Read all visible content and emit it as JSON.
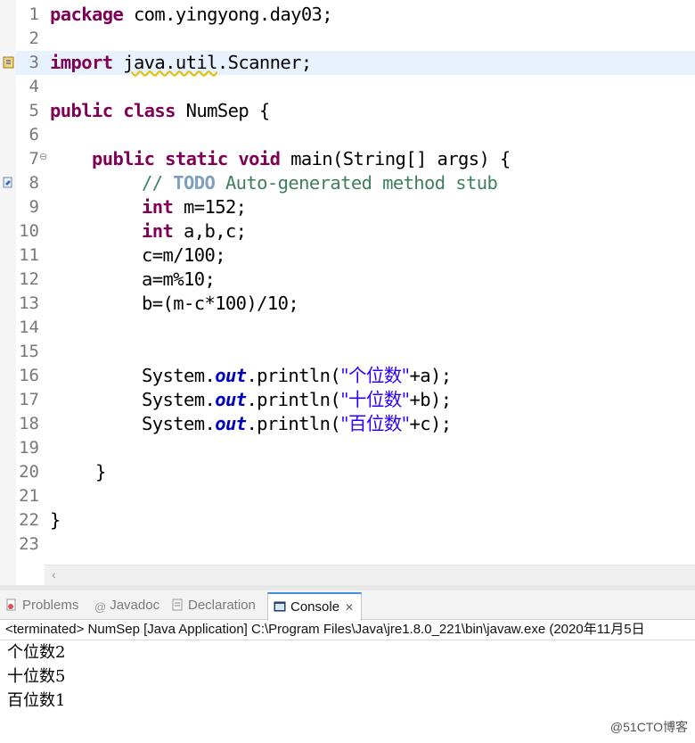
{
  "editor": {
    "line_numbers": [
      "1",
      "2",
      "3",
      "4",
      "5",
      "6",
      "7",
      "8",
      "9",
      "10",
      "11",
      "12",
      "13",
      "14",
      "15",
      "16",
      "17",
      "18",
      "19",
      "20",
      "21",
      "22",
      "23"
    ],
    "fold_marker": "⊖",
    "lines": {
      "l1_kw": "package",
      "l1_rest": " com.yingyong.day03;",
      "l3_kw": "import",
      "l3_rest_a": " ",
      "l3_pkg": "java.util",
      "l3_rest_b": ".Scanner;",
      "l5_kw1": "public",
      "l5_kw2": "class",
      "l5_rest": " NumSep {",
      "l7_indent": "    ",
      "l7_kw1": "public",
      "l7_kw2": "static",
      "l7_kw3": "void",
      "l7_rest": " main(String[] args) {",
      "l8_comment_a": "// ",
      "l8_todo": "TODO",
      "l8_comment_b": " Auto-generated method stub",
      "l9_kw": "int",
      "l9_rest": " m=152;",
      "l10_kw": "int",
      "l10_rest": " a,b,c;",
      "l11": "c=m/100;",
      "l12": "a=m%10;",
      "l13": "b=(m-c*100)/10;",
      "l16_a": "System.",
      "l16_out": "out",
      "l16_b": ".println(",
      "l16_str": "\"个位数\"",
      "l16_c": "+a);",
      "l17_a": "System.",
      "l17_out": "out",
      "l17_b": ".println(",
      "l17_str": "\"十位数\"",
      "l17_c": "+b);",
      "l18_a": "System.",
      "l18_out": "out",
      "l18_b": ".println(",
      "l18_str": "\"百位数\"",
      "l18_c": "+c);",
      "l20": "}",
      "l22": "}"
    }
  },
  "panel": {
    "tabs": [
      {
        "label": "Problems",
        "icon": "problems-icon"
      },
      {
        "label": "Javadoc",
        "icon": "javadoc-icon"
      },
      {
        "label": "Declaration",
        "icon": "declaration-icon"
      },
      {
        "label": "Console",
        "icon": "console-icon"
      }
    ],
    "close_glyph": "✕",
    "console_header": "<terminated> NumSep [Java Application] C:\\Program Files\\Java\\jre1.8.0_221\\bin\\javaw.exe  (2020年11月5日",
    "output": [
      "个位数2",
      "十位数5",
      "百位数1"
    ]
  },
  "watermark": "@51CTO博客",
  "colors": {
    "keyword": "#7f0055",
    "comment": "#3f7f5f",
    "string": "#2a00ff",
    "field": "#0000c0",
    "current_line": "#e8f2fe",
    "active_tab_accent": "#3d8fe0"
  }
}
